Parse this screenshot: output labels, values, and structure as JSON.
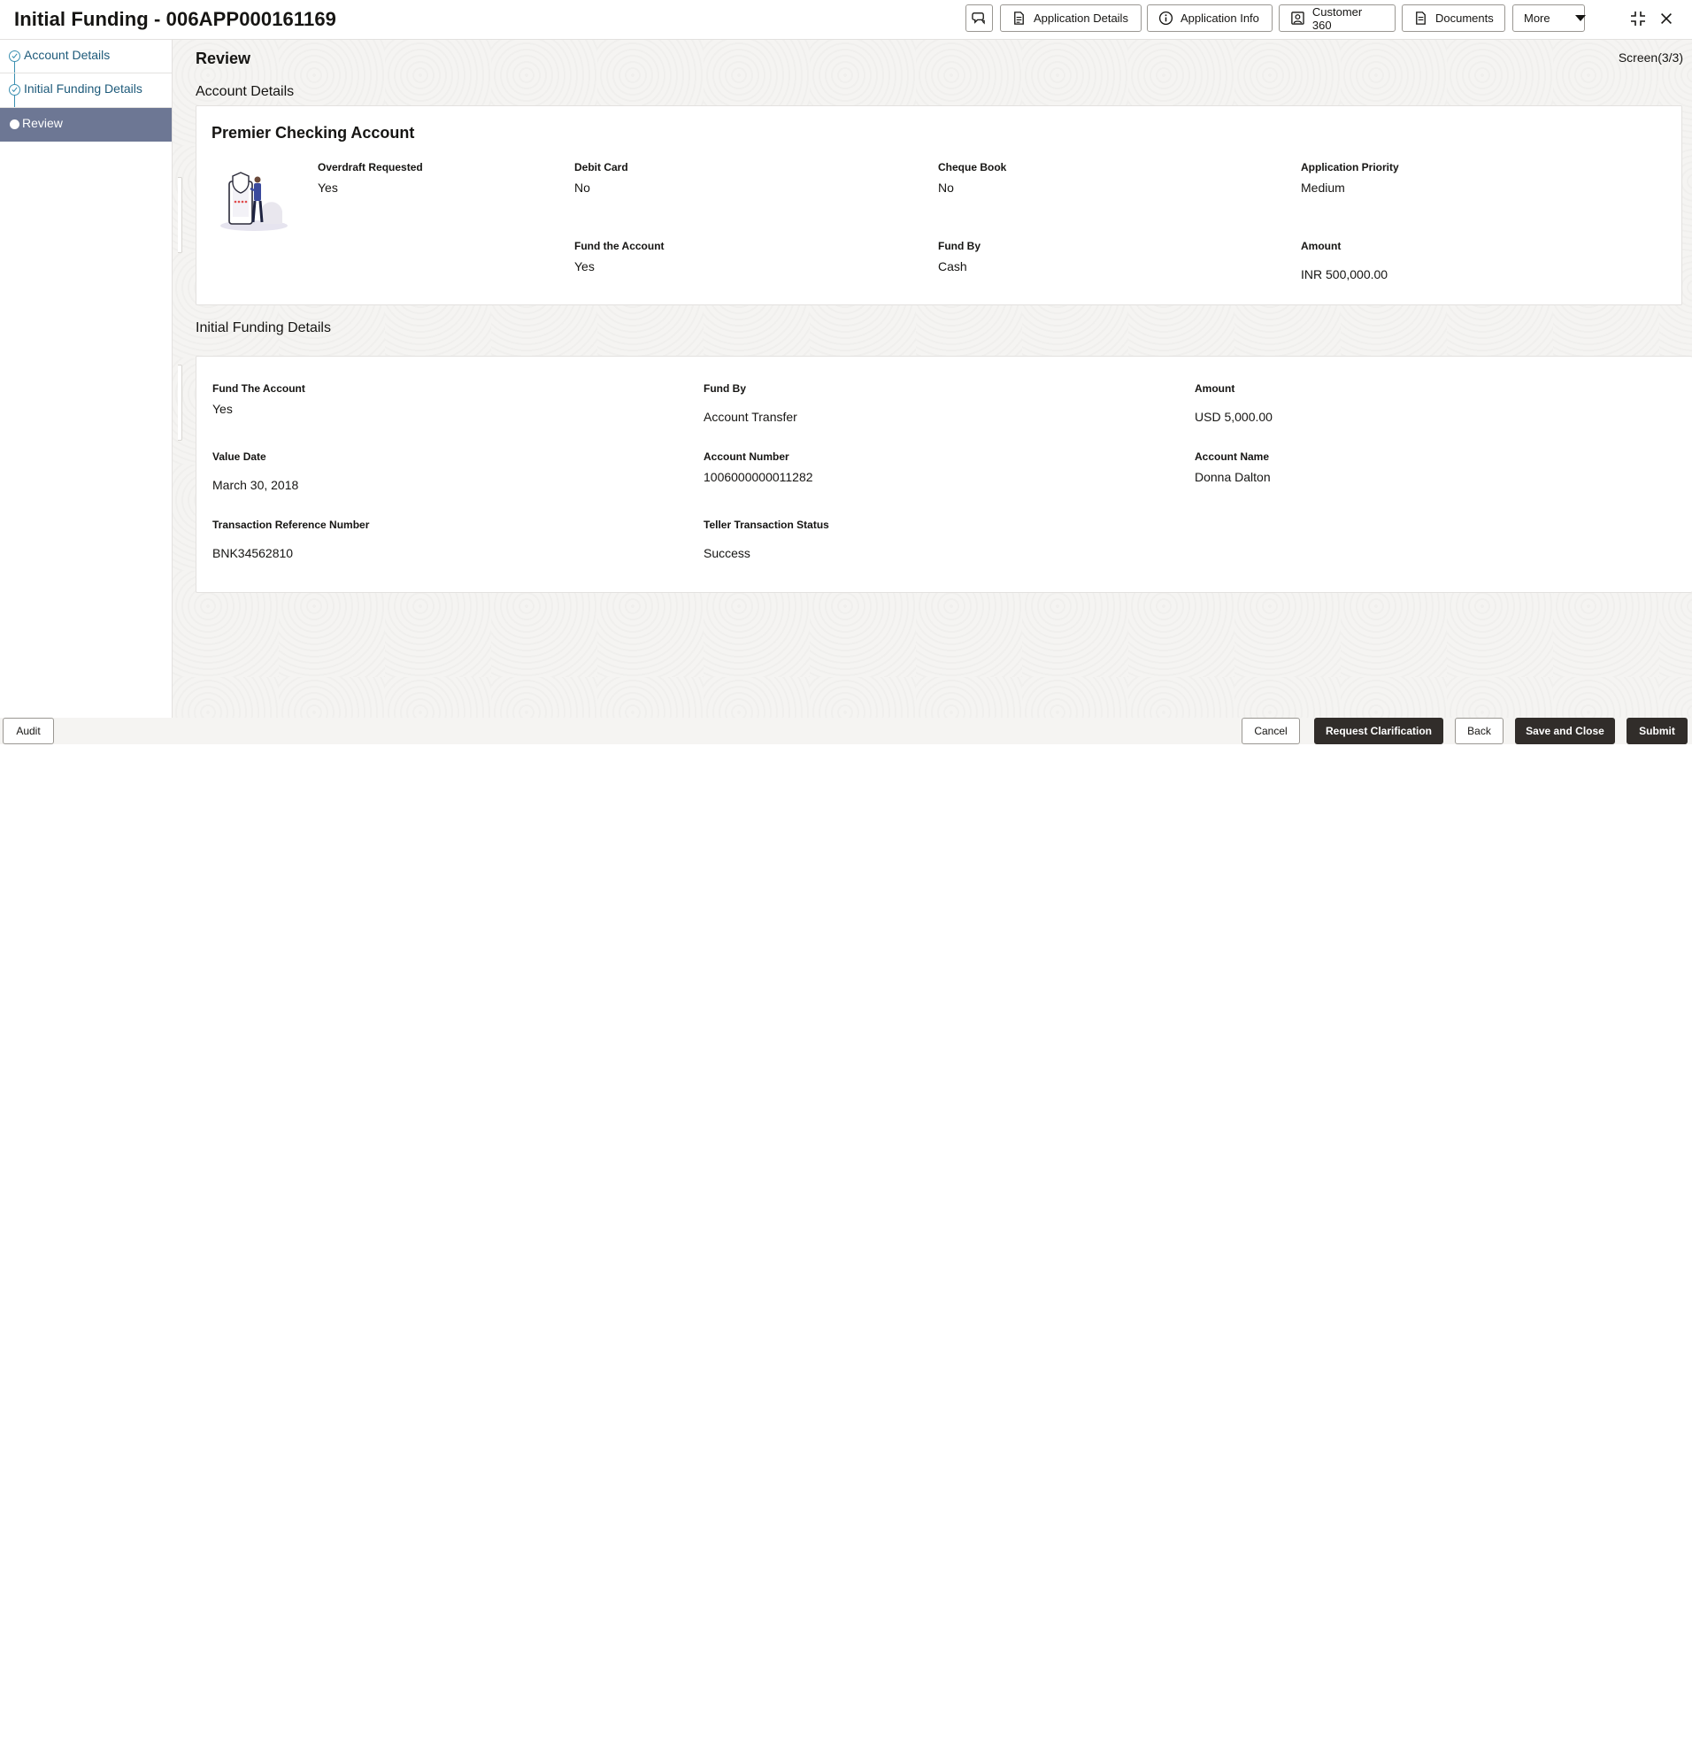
{
  "header": {
    "title": "Initial Funding - 006APP000161169",
    "buttons": {
      "application_details": "Application Details",
      "application_info": "Application Info",
      "customer_360": "Customer 360",
      "documents": "Documents",
      "more": "More"
    }
  },
  "sidebar": {
    "steps": [
      {
        "label": "Account Details"
      },
      {
        "label": "Initial Funding Details"
      },
      {
        "label": "Review"
      }
    ]
  },
  "main": {
    "title": "Review",
    "screen_indicator": "Screen(3/3)",
    "account_section": {
      "heading": "Account Details",
      "product_name": "Premier Checking Account",
      "fields": {
        "overdraft_requested": {
          "label": "Overdraft Requested",
          "value": "Yes"
        },
        "debit_card": {
          "label": "Debit Card",
          "value": "No"
        },
        "cheque_book": {
          "label": "Cheque Book",
          "value": "No"
        },
        "application_priority": {
          "label": "Application Priority",
          "value": "Medium"
        },
        "fund_the_account": {
          "label": "Fund the Account",
          "value": "Yes"
        },
        "fund_by": {
          "label": "Fund By",
          "value": "Cash"
        },
        "amount": {
          "label": "Amount",
          "value": "INR 500,000.00"
        }
      }
    },
    "funding_section": {
      "heading": "Initial Funding Details",
      "fields": {
        "fund_the_account": {
          "label": "Fund The Account",
          "value": "Yes"
        },
        "fund_by": {
          "label": "Fund By",
          "value": "Account Transfer"
        },
        "amount": {
          "label": "Amount",
          "value": "USD 5,000.00"
        },
        "value_date": {
          "label": "Value Date",
          "value": "March 30, 2018"
        },
        "account_number": {
          "label": "Account Number",
          "value": "1006000000011282"
        },
        "account_name": {
          "label": "Account Name",
          "value": "Donna Dalton"
        },
        "txn_ref": {
          "label": "Transaction Reference Number",
          "value": "BNK34562810"
        },
        "teller_status": {
          "label": "Teller Transaction Status",
          "value": "Success"
        }
      }
    }
  },
  "footer": {
    "audit": "Audit",
    "cancel": "Cancel",
    "request_clarification": "Request Clarification",
    "back": "Back",
    "save_and_close": "Save and Close",
    "submit": "Submit"
  }
}
